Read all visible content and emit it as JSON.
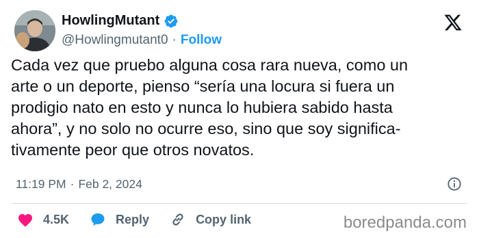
{
  "author": {
    "display_name": "HowlingMutant",
    "handle": "@Howlingmutant0",
    "separator": "·",
    "follow_label": "Follow",
    "verified": true
  },
  "tweet": {
    "text": "Cada vez que pruebo alguna cosa rara nueva, como un\narte o un deporte, pienso “sería una locura si fuera un\nprodigio nato en esto y nunca lo hubiera sabido hasta\nahora”, y no solo no ocurre eso, sino que soy significa-\ntivamente peor que otros novatos.",
    "time": "11:19 PM",
    "date_separator": "·",
    "date": "Feb 2, 2024"
  },
  "actions": {
    "likes": "4.5K",
    "reply_label": "Reply",
    "copy_link_label": "Copy link"
  },
  "watermark": "boredpanda.com",
  "colors": {
    "accent": "#1d9bf0",
    "like": "#f91880",
    "text": "#0f1419",
    "muted": "#536471"
  },
  "icons": [
    "verified-icon",
    "x-logo-icon",
    "info-icon",
    "heart-icon",
    "reply-icon",
    "link-icon"
  ]
}
